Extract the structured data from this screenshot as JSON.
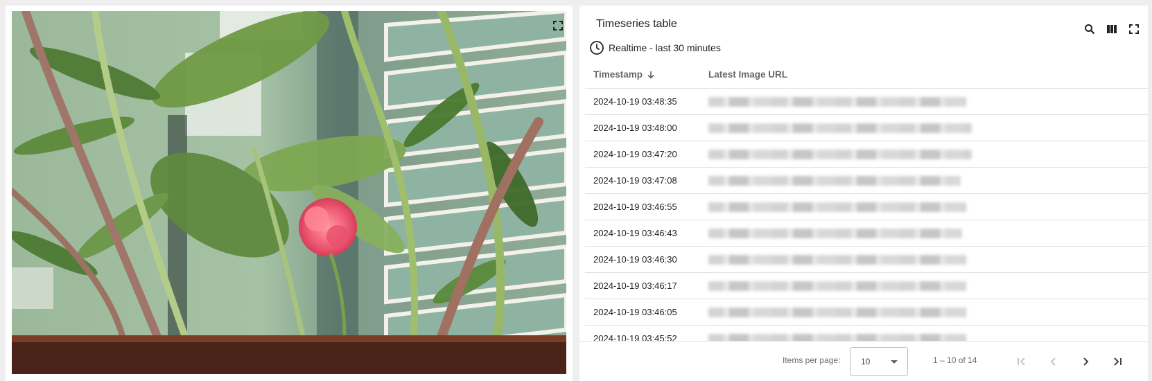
{
  "image_widget": {
    "fullscreen_icon": "fullscreen-icon"
  },
  "table_widget": {
    "title": "Timeseries table",
    "icons": {
      "search": "search-icon",
      "columns": "columns-icon",
      "fullscreen": "fullscreen-icon",
      "clock": "clock-icon",
      "sort": "arrow-down-icon"
    },
    "timewindow": "Realtime - last 30 minutes",
    "columns": {
      "timestamp": "Timestamp",
      "url": "Latest Image URL"
    },
    "rows": [
      {
        "timestamp": "2024-10-19 03:48:35"
      },
      {
        "timestamp": "2024-10-19 03:48:00"
      },
      {
        "timestamp": "2024-10-19 03:47:20"
      },
      {
        "timestamp": "2024-10-19 03:47:08"
      },
      {
        "timestamp": "2024-10-19 03:46:55"
      },
      {
        "timestamp": "2024-10-19 03:46:43"
      },
      {
        "timestamp": "2024-10-19 03:46:30"
      },
      {
        "timestamp": "2024-10-19 03:46:17"
      },
      {
        "timestamp": "2024-10-19 03:46:05"
      },
      {
        "timestamp": "2024-10-19 03:45:52"
      }
    ],
    "paginator": {
      "items_per_page_label": "Items per page:",
      "items_per_page_value": "10",
      "range_label": "1 – 10 of 14"
    }
  }
}
